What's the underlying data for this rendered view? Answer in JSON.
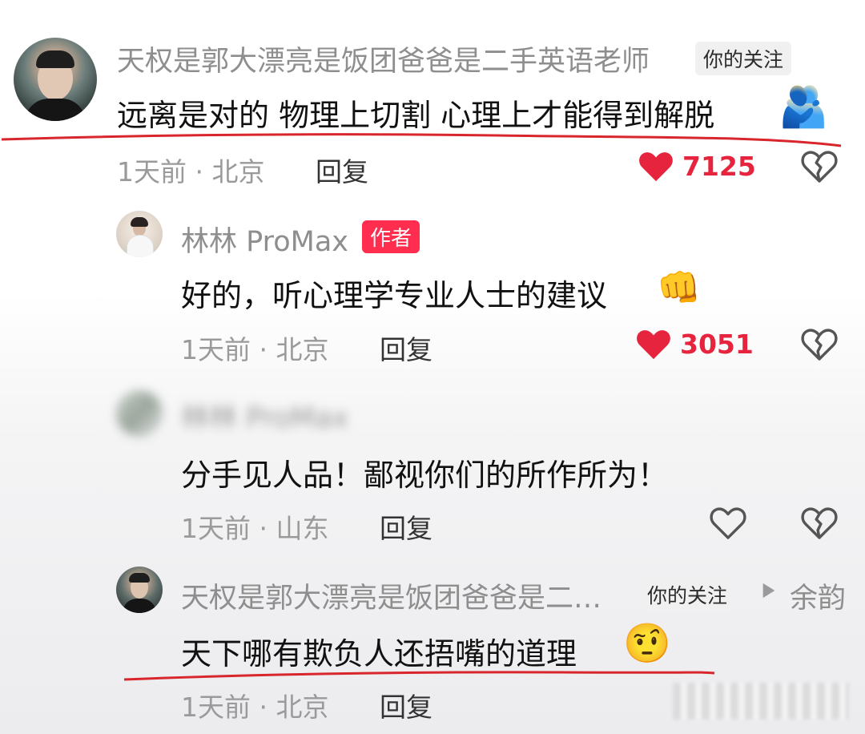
{
  "comments": [
    {
      "username": "天权是郭大漂亮是饭团爸爸是二手英语老师",
      "follow_tag": "你的关注",
      "text": "远离是对的 物理上切割 心理上才能得到解脱",
      "time_location": "1天前 · 北京",
      "reply_label": "回复",
      "like_count": "7125"
    },
    {
      "username": "林林 ProMax",
      "author_tag": "作者",
      "text": "好的，听心理学专业人士的建议",
      "time_location": "1天前 · 北京",
      "reply_label": "回复",
      "like_count": "3051"
    },
    {
      "username": "林林 ProMax",
      "text": "分手见人品！鄙视你们的所作所为！",
      "time_location": "1天前 · 山东",
      "reply_label": "回复"
    },
    {
      "username": "天权是郭大漂亮是饭团爸爸是二…",
      "follow_tag": "你的关注",
      "reply_to": "余韵",
      "text": "天下哪有欺负人还捂嘴的道理",
      "time_location": "1天前 · 北京",
      "reply_label": "回复"
    }
  ],
  "colors": {
    "like_red": "#e6243d",
    "underline_red": "#d9262c",
    "author_tag_bg": "#ff2d4e",
    "name_gray": "#8e8e8e"
  },
  "icons": [
    "heart-filled-icon",
    "heart-outline-icon",
    "broken-heart-icon",
    "play-triangle-icon"
  ]
}
